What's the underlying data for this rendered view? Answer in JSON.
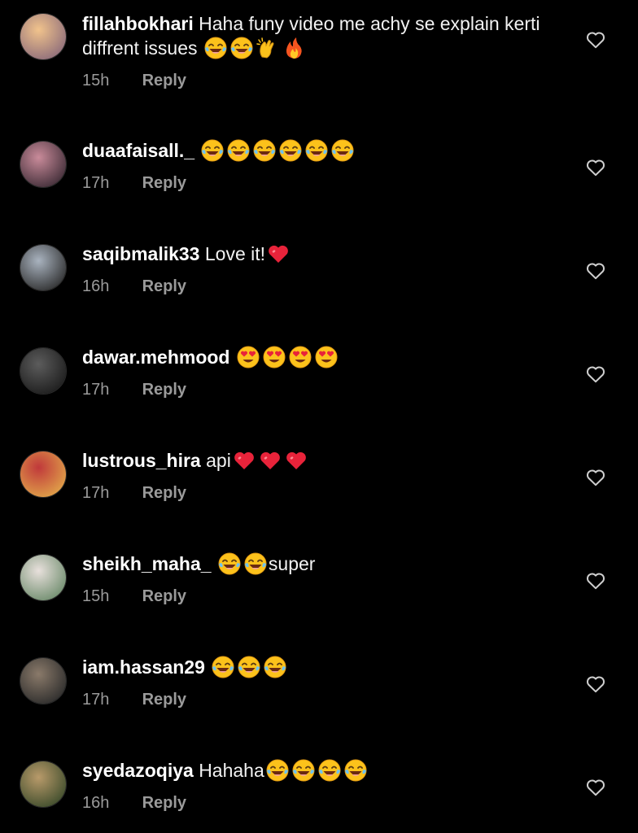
{
  "comments": [
    {
      "username": "fillahbokhari",
      "text": "Haha funy video me achy se explain kerti diffrent issues",
      "emojis_after": [
        "laughing-tears",
        "laughing-tears",
        "clapping-hands",
        "fire"
      ],
      "time": "15h",
      "reply": "Reply",
      "avatar_colors": [
        "#f1c38c",
        "#8a6a7a"
      ]
    },
    {
      "username": "duaafaisall._",
      "text": "",
      "emojis_after": [
        "laughing-tears",
        "laughing-tears",
        "laughing-tears",
        "laughing-tears",
        "laughing-tears",
        "laughing-tears"
      ],
      "time": "17h",
      "reply": "Reply",
      "avatar_colors": [
        "#c98b9a",
        "#3b2a34"
      ]
    },
    {
      "username": "saqibmalik33",
      "text": "Love it!",
      "emojis_after": [
        "red-heart"
      ],
      "time": "16h",
      "reply": "Reply",
      "avatar_colors": [
        "#a9b3bf",
        "#2b2b2b"
      ]
    },
    {
      "username": "dawar.mehmood",
      "text": "",
      "emojis_after": [
        "heart-eyes",
        "heart-eyes",
        "heart-eyes",
        "heart-eyes"
      ],
      "time": "17h",
      "reply": "Reply",
      "avatar_colors": [
        "#5c5c5c",
        "#1b1b1b"
      ]
    },
    {
      "username": "lustrous_hira",
      "text": "api",
      "emojis_after": [
        "red-heart",
        "red-heart",
        "red-heart"
      ],
      "time": "17h",
      "reply": "Reply",
      "avatar_colors": [
        "#c0393b",
        "#e2a84a"
      ]
    },
    {
      "username": "sheikh_maha_",
      "text": "",
      "emojis_after": [
        "laughing-tears",
        "laughing-tears"
      ],
      "text_after": "super",
      "time": "15h",
      "reply": "Reply",
      "avatar_colors": [
        "#e8e0dc",
        "#6b8a6a"
      ]
    },
    {
      "username": "iam.hassan29",
      "text": "",
      "emojis_after": [
        "laughing-tears",
        "laughing-tears",
        "laughing-tears"
      ],
      "time": "17h",
      "reply": "Reply",
      "avatar_colors": [
        "#8a7a6a",
        "#2a2a2a"
      ]
    },
    {
      "username": "syedazoqiya",
      "text": "Hahaha",
      "emojis_after": [
        "laughing-tears",
        "laughing-tears",
        "laughing-tears",
        "laughing-tears"
      ],
      "time": "16h",
      "reply": "Reply",
      "avatar_colors": [
        "#b89a6a",
        "#3a4a2a"
      ]
    }
  ],
  "icons": {
    "like": "heart-outline-icon"
  },
  "colors": {
    "background": "#000000",
    "text": "#f2f2f2",
    "muted": "#9a9a9a"
  }
}
